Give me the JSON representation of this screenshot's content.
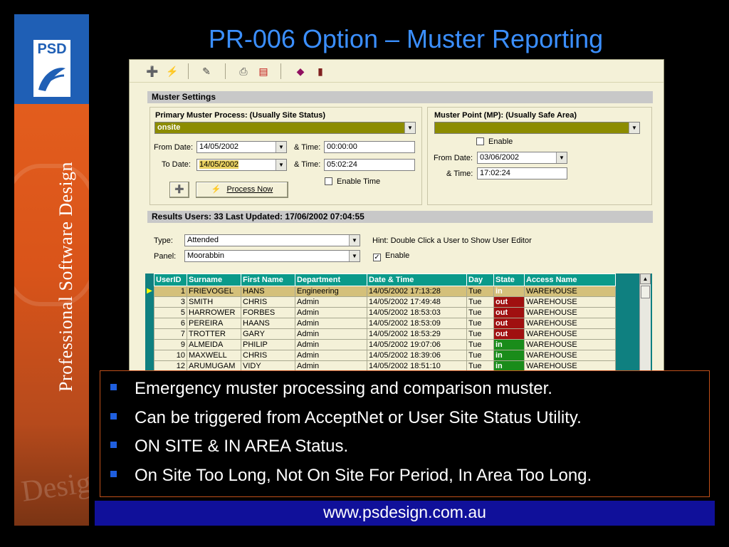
{
  "brand": {
    "logo_text": "PSD",
    "vertical_text": "Professional Software Design",
    "ghost_text": "Design",
    "colors": {
      "strip": "#e8621f",
      "logo_box": "#1f5fb5"
    }
  },
  "slide": {
    "title_main": "PR-006 Option",
    "title_dash": " – ",
    "title_tail": "Muster Reporting"
  },
  "app": {
    "toolbar_icons": [
      "add-user-icon",
      "lightning-icon",
      "brush-icon",
      "print-icon",
      "export-icon",
      "book-icon",
      "exit-icon"
    ],
    "muster_settings": {
      "band_label": "Muster Settings",
      "primary_label": "Primary Muster Process:  (Usually Site Status)",
      "primary_value": "onsite",
      "from_date_label": "From Date:",
      "from_date": "14/05/2002",
      "from_time_label": "& Time:",
      "from_time": "00:00:00",
      "to_date_label": "To Date:",
      "to_date": "14/05/2002",
      "to_time_label": "& Time:",
      "to_time": "05:02:24",
      "enable_time_label": "Enable Time",
      "process_now_label": "Process Now",
      "mp_label": "Muster Point (MP): (Usually Safe Area)",
      "mp_value": "",
      "mp_enable_label": "Enable",
      "mp_from_date_label": "From Date:",
      "mp_from_date": "03/06/2002",
      "mp_time_label": "& Time:",
      "mp_time": "17:02:24"
    },
    "results": {
      "band_label": "Results Users:  33   Last Updated: 17/06/2002  07:04:55",
      "type_label": "Type:",
      "type_value": "Attended",
      "panel_label": "Panel:",
      "panel_value": "Moorabbin",
      "hint": "Hint: Double Click a User to Show User Editor",
      "enable_label": "Enable"
    },
    "grid": {
      "columns": [
        "UserID",
        "Surname",
        "First Name",
        "Department",
        "Date & Time",
        "Day",
        "State",
        "Access Name"
      ],
      "rows": [
        [
          "1",
          "FRIEVOGEL",
          "HANS",
          "Engineering",
          "14/05/2002 17:13:28",
          "Tue",
          "in",
          "WAREHOUSE"
        ],
        [
          "3",
          "SMITH",
          "CHRIS",
          "Admin",
          "14/05/2002 17:49:48",
          "Tue",
          "out",
          "WAREHOUSE"
        ],
        [
          "5",
          "HARROWER",
          "FORBES",
          "Admin",
          "14/05/2002 18:53:03",
          "Tue",
          "out",
          "WAREHOUSE"
        ],
        [
          "6",
          "PEREIRA",
          "HAANS",
          "Admin",
          "14/05/2002 18:53:09",
          "Tue",
          "out",
          "WAREHOUSE"
        ],
        [
          "7",
          "TROTTER",
          "GARY",
          "Admin",
          "14/05/2002 18:53:29",
          "Tue",
          "out",
          "WAREHOUSE"
        ],
        [
          "9",
          "ALMEIDA",
          "PHILIP",
          "Admin",
          "14/05/2002 19:07:06",
          "Tue",
          "in",
          "WAREHOUSE"
        ],
        [
          "10",
          "MAXWELL",
          "CHRIS",
          "Admin",
          "14/05/2002 18:39:06",
          "Tue",
          "in",
          "WAREHOUSE"
        ],
        [
          "12",
          "ARUMUGAM",
          "VIDY",
          "Admin",
          "14/05/2002 18:51:10",
          "Tue",
          "in",
          "WAREHOUSE"
        ]
      ],
      "colors": {
        "in": "#1a8c1a",
        "out": "#a01010",
        "header": "#0a9a8a"
      }
    }
  },
  "bullets": [
    "Emergency muster processing and comparison muster.",
    "Can be triggered from AcceptNet or User Site Status Utility.",
    "ON SITE & IN AREA Status.",
    "On Site Too Long, Not On Site For Period, In Area Too Long."
  ],
  "footer": {
    "url": "www.psdesign.com.au"
  }
}
